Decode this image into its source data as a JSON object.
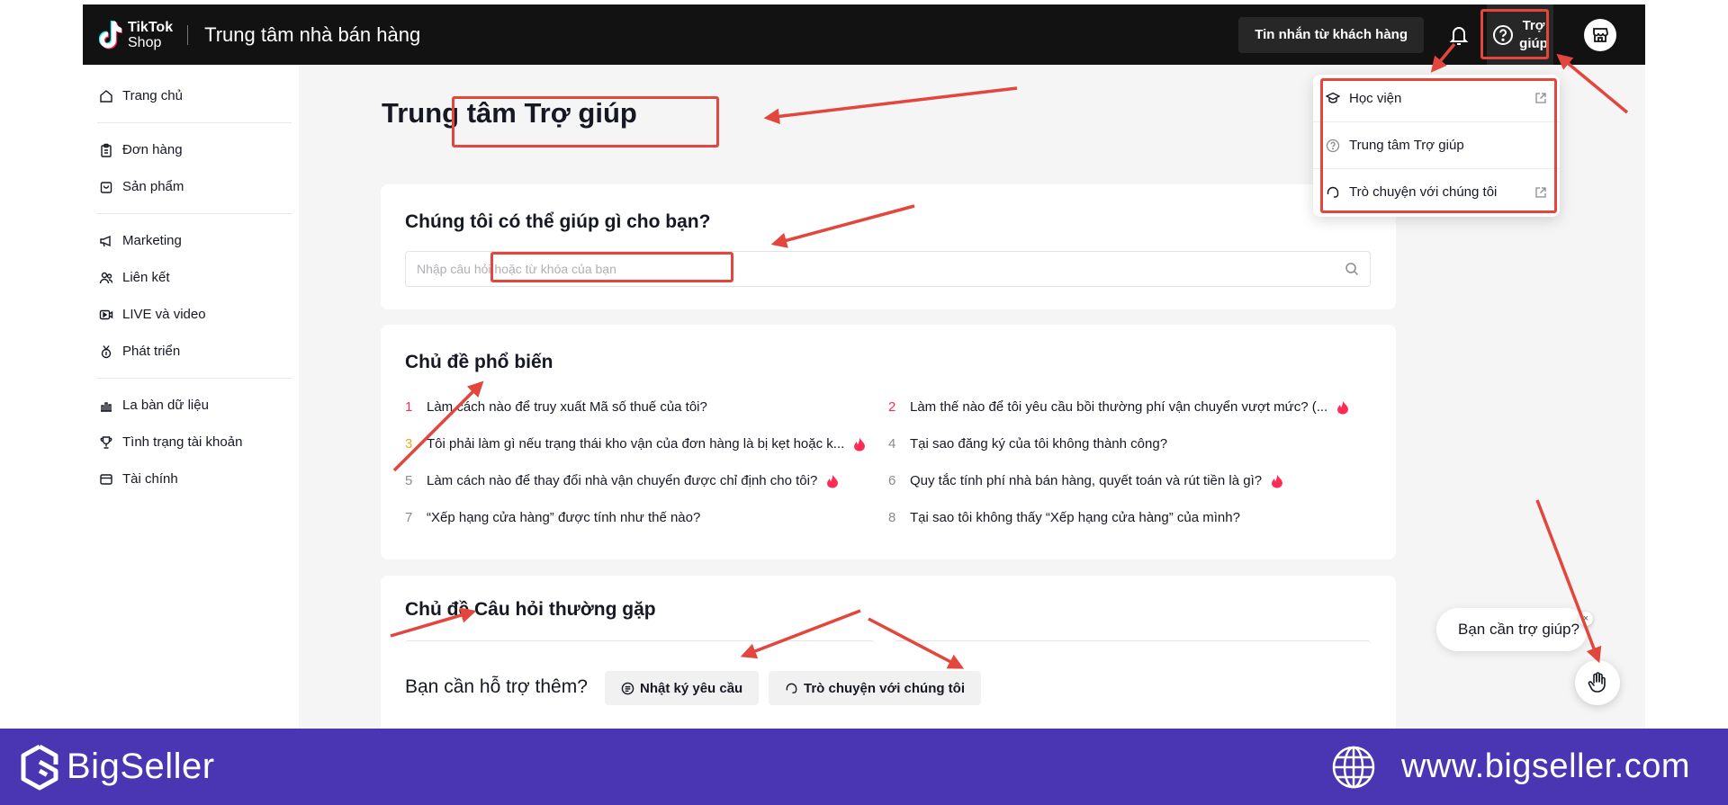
{
  "topbar": {
    "brand_line1": "TikTok",
    "brand_line2": "Shop",
    "title": "Trung tâm nhà bán hàng",
    "messages_button": "Tin nhắn từ khách hàng",
    "help_button_line1": "Trợ",
    "help_button_line2": "giúp"
  },
  "sidebar": {
    "items": [
      {
        "label": "Trang chủ",
        "icon": "home-icon"
      },
      {
        "label": "Đơn hàng",
        "icon": "clipboard-icon"
      },
      {
        "label": "Sản phẩm",
        "icon": "bag-icon"
      },
      {
        "label": "Marketing",
        "icon": "megaphone-icon"
      },
      {
        "label": "Liên kết",
        "icon": "users-icon"
      },
      {
        "label": "LIVE và video",
        "icon": "video-icon"
      },
      {
        "label": "Phát triển",
        "icon": "medal-icon"
      },
      {
        "label": "La bàn dữ liệu",
        "icon": "bar-chart-icon"
      },
      {
        "label": "Tình trạng tài khoản",
        "icon": "trophy-icon"
      },
      {
        "label": "Tài chính",
        "icon": "wallet-icon"
      }
    ]
  },
  "main": {
    "page_title": "Trung tâm Trợ giúp",
    "search_card": {
      "heading": "Chúng tôi có thể giúp gì cho bạn?",
      "placeholder": "Nhập câu hỏi hoặc từ khóa của bạn"
    },
    "popular": {
      "heading": "Chủ đề phổ biến",
      "topics": [
        {
          "num": "1",
          "text": "Làm cách nào để truy xuất Mã số thuế của tôi?",
          "hot": false
        },
        {
          "num": "2",
          "text": "Làm thế nào để tôi yêu cầu bồi thường phí vận chuyển vượt mức? (...",
          "hot": true
        },
        {
          "num": "3",
          "text": "Tôi phải làm gì nếu trạng thái kho vận của đơn hàng là bị kẹt hoặc k...",
          "hot": true
        },
        {
          "num": "4",
          "text": "Tại sao đăng ký của tôi không thành công?",
          "hot": false
        },
        {
          "num": "5",
          "text": "Làm cách nào để thay đổi nhà vận chuyển được chỉ định cho tôi?",
          "hot": true
        },
        {
          "num": "6",
          "text": "Quy tắc tính phí nhà bán hàng, quyết toán và rút tiền là gì?",
          "hot": true
        },
        {
          "num": "7",
          "text": "“Xếp hạng cửa hàng” được tính như thế nào?",
          "hot": false
        },
        {
          "num": "8",
          "text": "Tại sao tôi không thấy “Xếp hạng cửa hàng” của mình?",
          "hot": false
        }
      ],
      "rank_colors": {
        "1": "#fe2c55",
        "2": "#fe2c55",
        "3": "#f5a623"
      }
    },
    "faq": {
      "heading": "Chủ đề Câu hỏi thường gặp",
      "more_support": "Bạn cần hỗ trợ thêm?",
      "request_log": "Nhật ký yêu cầu",
      "chat_with_us": "Trò chuyện với chúng tôi"
    }
  },
  "help_dropdown": {
    "items": [
      {
        "label": "Học viện",
        "icon": "graduation-cap-icon",
        "external": true
      },
      {
        "label": "Trung tâm Trợ giúp",
        "icon": "question-circle-icon",
        "external": false
      },
      {
        "label": "Trò chuyện với chúng tôi",
        "icon": "headset-icon",
        "external": true
      }
    ]
  },
  "chat_bubble": {
    "text": "Bạn cần trợ giúp?",
    "close": "×"
  },
  "footer": {
    "brand": "BigSeller",
    "url": "www.bigseller.com",
    "background": "#4a36b2"
  },
  "colors": {
    "annotation_red": "#e2463d",
    "topbar": "#121212",
    "hot": "#fe2c55"
  }
}
